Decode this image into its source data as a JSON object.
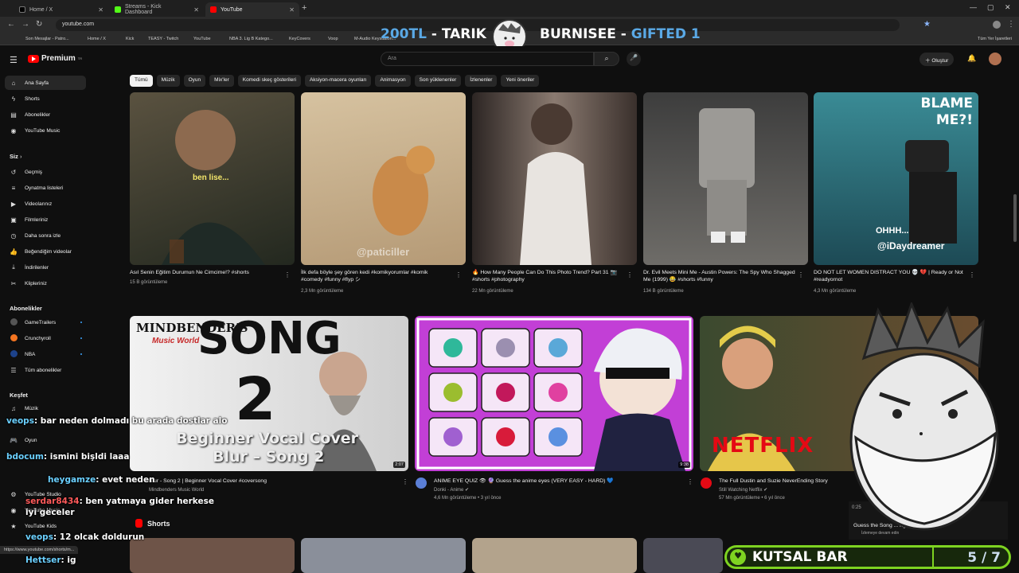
{
  "browser": {
    "tabs": [
      {
        "label": "Home / X",
        "active": false,
        "icon": "x-icon"
      },
      {
        "label": "Streams - Kick Dashboard",
        "active": false,
        "icon": "kick-icon"
      },
      {
        "label": "YouTube",
        "active": true,
        "icon": "youtube-icon"
      }
    ],
    "url": "youtube.com",
    "bookmarks": [
      "Son Mesajlar - Patro...",
      "Home / X",
      "Kick",
      "TEASY - Twitch",
      "YouTube",
      "NBA 3. Lig B Katego...",
      "KeyCovers",
      "Voop",
      "M-Audio Keystation...",
      "Tüm Yer İşaretleri"
    ],
    "status_url": "https://www.youtube.com/shorts/m..."
  },
  "stream_overlay": {
    "donation_left": {
      "amount": "200TL",
      "sep": " - ",
      "name": "TARIK"
    },
    "donation_right": {
      "name": "BURNISEE",
      "sep": " - ",
      "gift": "GIFTED 1"
    },
    "kutsal_bar": {
      "label": "KUTSAL BAR",
      "count": "5 / 7"
    }
  },
  "youtube": {
    "logo": "Premium",
    "logo_sup": "TR",
    "search_placeholder": "Ara",
    "create_label": "Oluştur",
    "chips": [
      "Tümü",
      "Müzik",
      "Oyun",
      "Mix'ler",
      "Komedi skeç gösterileri",
      "Aksiyon-macera oyunları",
      "Animasyon",
      "Son yüklenenler",
      "İzlenenler",
      "Yeni öneriler"
    ],
    "sidebar": {
      "main": [
        {
          "label": "Ana Sayfa",
          "icon": "home-icon",
          "active": true
        },
        {
          "label": "Shorts",
          "icon": "shorts-icon"
        },
        {
          "label": "Abonelikler",
          "icon": "subscriptions-icon"
        },
        {
          "label": "YouTube Music",
          "icon": "music-icon"
        }
      ],
      "you_header": "Siz",
      "you": [
        {
          "label": "Geçmiş",
          "icon": "history-icon"
        },
        {
          "label": "Oynatma listeleri",
          "icon": "playlist-icon"
        },
        {
          "label": "Videolarınız",
          "icon": "video-icon"
        },
        {
          "label": "Filmleriniz",
          "icon": "film-icon"
        },
        {
          "label": "Daha sonra izle",
          "icon": "clock-icon"
        },
        {
          "label": "Beğendiğim videolar",
          "icon": "like-icon"
        },
        {
          "label": "İndirilenler",
          "icon": "download-icon"
        },
        {
          "label": "Klipleriniz",
          "icon": "clip-icon"
        }
      ],
      "subs_header": "Abonelikler",
      "subs": [
        {
          "label": "GameTrailers",
          "color": "#555555"
        },
        {
          "label": "Crunchyroll",
          "color": "#f47521"
        },
        {
          "label": "NBA",
          "color": "#1d428a"
        },
        {
          "label": "Tüm abonelikler",
          "icon": "list-icon"
        }
      ],
      "explore_header": "Keşfet",
      "explore": [
        {
          "label": "Müzik",
          "icon": "music-note-icon"
        },
        {
          "label": "Oyun",
          "icon": "gamepad-icon"
        }
      ],
      "more": [
        {
          "label": "YouTube Studio"
        },
        {
          "label": "YouTube Music"
        },
        {
          "label": "YouTube Kids"
        }
      ]
    },
    "row1": [
      {
        "title": "Asıl Senin Eğitim Durumun Ne Cimcime!? #shorts",
        "views": "15 B görüntüleme",
        "caption": "ben lise...",
        "thumb_color": "#3a3d2c"
      },
      {
        "title": "İlk defa böyle şey gören kedi #komikyorumlar #komik #comedy #funny #flyp シ",
        "views": "2,3 Mn görüntüleme",
        "caption": "@paticiller",
        "thumb_color": "#c9b08a"
      },
      {
        "title": "🔥 How Many People Can Do This Photo Trend? Part 31 📷 #shorts #photography",
        "views": "22 Mn görüntüleme",
        "caption": "",
        "thumb_color": "#6a5a52"
      },
      {
        "title": "Dr. Evil Meets Mini Me - Austin Powers: The Spy Who Shagged Me (1999) 😂 #shorts #funny",
        "views": "134 B görüntüleme",
        "caption": "",
        "thumb_color": "#55534f"
      },
      {
        "title": "DO NOT LET WOMEN DISTRACT YOU 💀 💔 | Ready or Not #readyornot",
        "views": "4,3 Mn görüntüleme",
        "caption": "BLAME ME?!",
        "caption2": "OHHH...",
        "caption3": "@iDaydreamer",
        "thumb_color": "#2e6e7a"
      }
    ],
    "row2": [
      {
        "title": "Blur - Song 2 | Beginner Vocal Cover #coversong",
        "channel": "Mindbenders Music World",
        "meta": "",
        "duration": "2:07",
        "thumb_text1": "MINDBENDER'S",
        "thumb_text2": "Music World",
        "thumb_text3": "SONG",
        "thumb_text4": "2",
        "thumb_text5": "Beginner Vocal Cover",
        "thumb_text6": "Blur – Song 2"
      },
      {
        "title": "ANIME EYE QUIZ 👁 🔮 Guess the anime eyes (VERY EASY - HARD) 💙",
        "channel": "Donki - Anime ✔",
        "meta": "4,6 Mn görüntüleme • 3 yıl önce",
        "duration": "9:38"
      },
      {
        "title": "The Full Dustin and Suzie NeverEnding Story",
        "channel": "Still Watching Netflix ✔",
        "meta": "57 Mn görüntüleme • 6 yıl önce",
        "duration": "",
        "thumb_text1": "NETFLIX"
      }
    ],
    "mix_card": {
      "title": "Guess the Song ... ngs 2000-2024 |",
      "sub": "İzlemeye devam edin",
      "time": "0:25"
    },
    "shorts_header": "Shorts"
  },
  "chat": [
    {
      "user": "veops",
      "text": ": bar neden dolmadı bu arada dostlar alo",
      "color": "blue"
    },
    {
      "user": "bdocum",
      "text": ": ismini bişldi laaa",
      "color": "blue"
    },
    {
      "user": "heygamze",
      "text": ": evet neden",
      "color": "blue"
    },
    {
      "user": "serdar8434",
      "text": ": ben yatmaya gider herkese iyi geceler",
      "color": "red"
    },
    {
      "user": "veops",
      "text": ": 12 olcak doldurun",
      "color": "blue"
    },
    {
      "user": "Hettser",
      "text": ": ig",
      "color": "blue"
    }
  ]
}
